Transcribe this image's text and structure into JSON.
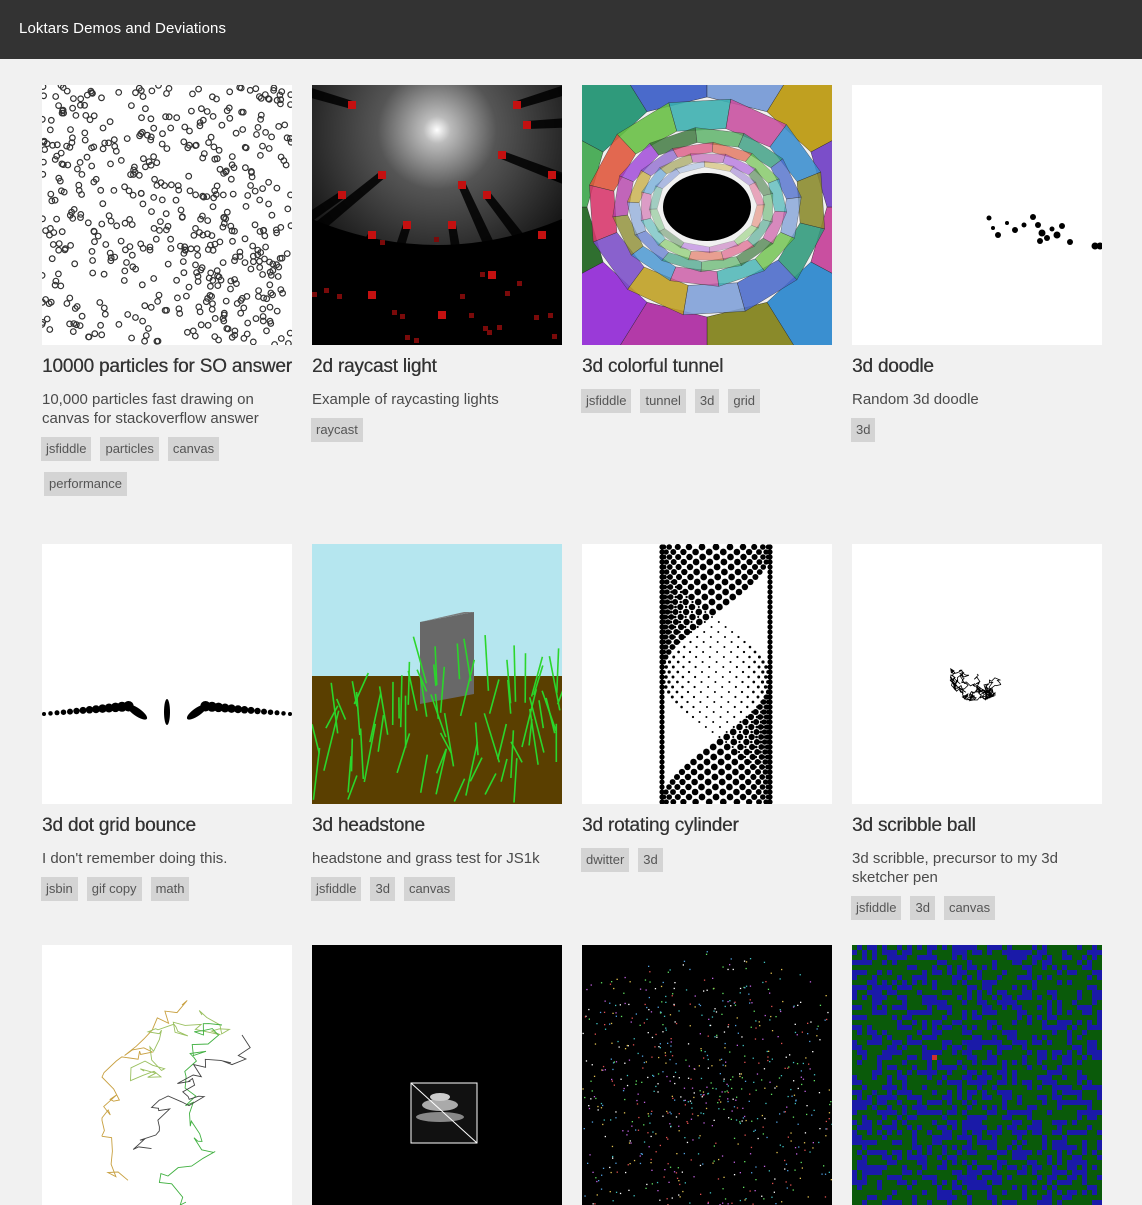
{
  "header": {
    "title": "Loktars Demos and Deviations"
  },
  "cards": [
    {
      "title": "10000 particles for SO answer",
      "description": "10,000 particles fast drawing on canvas for stackoverflow answer",
      "tags": [
        "jsfiddle",
        "particles",
        "canvas",
        "performance"
      ]
    },
    {
      "title": "2d raycast light",
      "description": "Example of raycasting lights",
      "tags": [
        "raycast"
      ]
    },
    {
      "title": "3d colorful tunnel",
      "description": "",
      "tags": [
        "jsfiddle",
        "tunnel",
        "3d",
        "grid"
      ]
    },
    {
      "title": "3d doodle",
      "description": "Random 3d doodle",
      "tags": [
        "3d"
      ]
    },
    {
      "title": "3d dot grid bounce",
      "description": "I don't remember doing this.",
      "tags": [
        "jsbin",
        "gif copy",
        "math"
      ]
    },
    {
      "title": "3d headstone",
      "description": "headstone and grass test for JS1k",
      "tags": [
        "jsfiddle",
        "3d",
        "canvas"
      ]
    },
    {
      "title": "3d rotating cylinder",
      "description": "",
      "tags": [
        "dwitter",
        "3d"
      ]
    },
    {
      "title": "3d scribble ball",
      "description": "3d scribble, precursor to my 3d sketcher pen",
      "tags": [
        "jsfiddle",
        "3d",
        "canvas"
      ]
    }
  ]
}
